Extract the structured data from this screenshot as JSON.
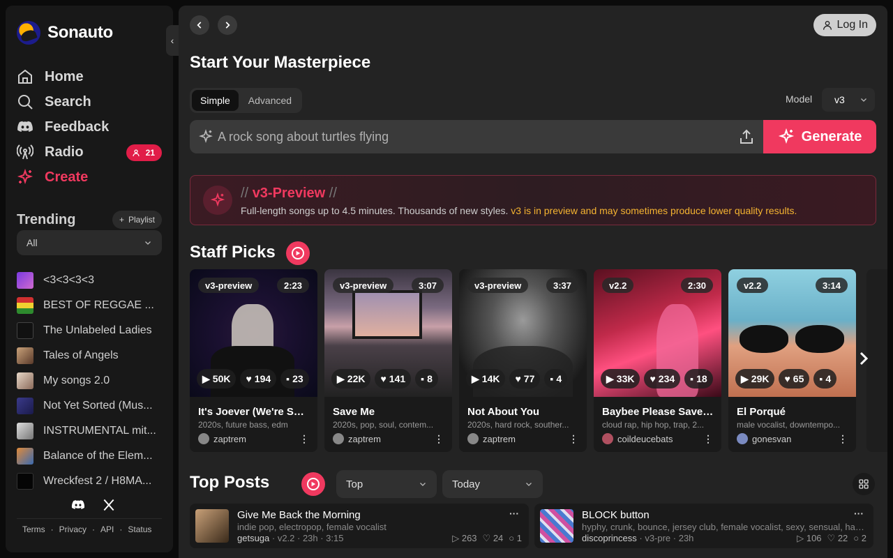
{
  "app": {
    "name": "Sonauto"
  },
  "sidebar": {
    "nav": [
      {
        "label": "Home",
        "icon": "home-icon"
      },
      {
        "label": "Search",
        "icon": "search-icon"
      },
      {
        "label": "Feedback",
        "icon": "discord-icon"
      },
      {
        "label": "Radio",
        "icon": "radio-icon",
        "badge": "21"
      },
      {
        "label": "Create",
        "icon": "sparkle-icon",
        "active": true
      }
    ],
    "trending_label": "Trending",
    "playlist_button": "Playlist",
    "filter_value": "All",
    "playlists": [
      {
        "name": "<3<3<3<3",
        "color": "#6a3ad0"
      },
      {
        "name": "BEST OF REGGAE ...",
        "color": "#2e8b2e"
      },
      {
        "name": "The Unlabeled Ladies",
        "color": "#222"
      },
      {
        "name": "Tales of Angels",
        "color": "#8a6d52"
      },
      {
        "name": "My songs 2.0",
        "color": "#a88f7a"
      },
      {
        "name": "Not Yet Sorted (Mus...",
        "color": "#2a2a6a"
      },
      {
        "name": "INSTRUMENTAL mit...",
        "color": "#9a9a9a"
      },
      {
        "name": "Balance of the Elem...",
        "color": "#4a7aa8"
      },
      {
        "name": "Wreckfest 2 / H8MA...",
        "color": "#111"
      }
    ],
    "footer": [
      "Terms",
      "·",
      "Privacy",
      "·",
      "API",
      "·",
      "Status"
    ]
  },
  "header": {
    "login_label": "Log In"
  },
  "create": {
    "title": "Start Your Masterpiece",
    "tabs": [
      "Simple",
      "Advanced"
    ],
    "model_label": "Model",
    "model_value": "v3",
    "prompt_placeholder": "A rock song about turtles flying",
    "generate_label": "Generate"
  },
  "banner": {
    "title": "v3-Preview",
    "slashes_left": "//",
    "slashes_right": "//",
    "desc": "Full-length songs up to 4.5 minutes. Thousands of new styles. ",
    "warning": "v3 is in preview and may sometimes produce lower quality results."
  },
  "staff_picks": {
    "title": "Staff Picks",
    "cards": [
      {
        "version": "v3-preview",
        "duration": "2:23",
        "plays": "50K",
        "likes": "194",
        "comments": "23",
        "title": "It's Joever (We're So ...",
        "tags": "2020s, future bass, edm",
        "user": "zaptrem",
        "art": "#3a2a5a"
      },
      {
        "version": "v3-preview",
        "duration": "3:07",
        "plays": "22K",
        "likes": "141",
        "comments": "8",
        "title": "Save Me",
        "tags": "2020s, pop, soul, contem...",
        "user": "zaptrem",
        "art": "#6a5a6a"
      },
      {
        "version": "v3-preview",
        "duration": "3:37",
        "plays": "14K",
        "likes": "77",
        "comments": "4",
        "title": "Not About You",
        "tags": "2020s, hard rock, souther...",
        "user": "zaptrem",
        "art": "#555"
      },
      {
        "version": "v2.2",
        "duration": "2:30",
        "plays": "33K",
        "likes": "234",
        "comments": "18",
        "title": "Baybee Please Save ...",
        "tags": "cloud rap, hip hop, trap, 2...",
        "user": "coildeucebats",
        "art": "#8a2040"
      },
      {
        "version": "v2.2",
        "duration": "3:14",
        "plays": "29K",
        "likes": "65",
        "comments": "4",
        "title": "El Porqué",
        "tags": "male vocalist, downtempo...",
        "user": "gonesvan",
        "art": "#6fb8c8"
      }
    ]
  },
  "top_posts": {
    "title": "Top Posts",
    "sort_value": "Top",
    "period_value": "Today",
    "posts": [
      {
        "title": "Give Me Back the Morning",
        "tags": "indie pop, electropop, female vocalist",
        "user": "getsuga",
        "meta": " · v2.2 · 23h · 3:15",
        "plays": "263",
        "likes": "24",
        "comments": "1",
        "thumb": "#8a6a4a"
      },
      {
        "title": "BLOCK button",
        "tags": "hyphy, crunk, bounce, jersey club, female vocalist, sexy, sensual, happ...",
        "user": "discoprincess",
        "meta": " · v3-pre · 23h",
        "plays": "106",
        "likes": "22",
        "comments": "2",
        "thumb": "#4a7ad0"
      }
    ]
  }
}
